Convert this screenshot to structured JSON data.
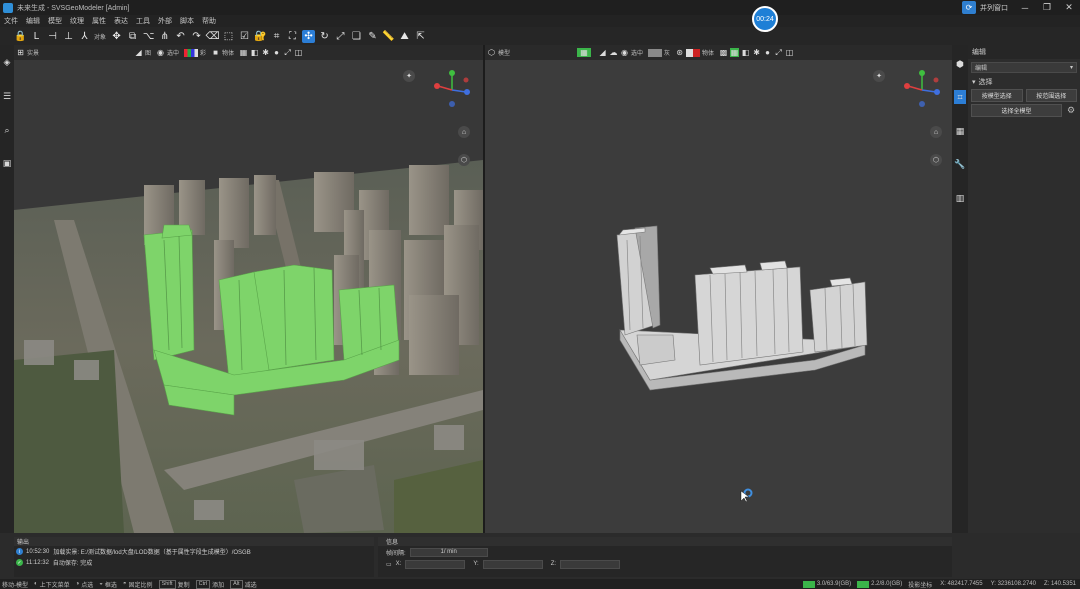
{
  "app": {
    "window_title": "未来生成 - SVSGeoModeler [Admin]",
    "timer": "00:24",
    "user_menu": "并列窗口"
  },
  "menu": [
    "文件",
    "编辑",
    "模型",
    "纹理",
    "属性",
    "表达",
    "工具",
    "外部",
    "脚本",
    "帮助"
  ],
  "toolbar": {
    "align_label": "对象",
    "icons": [
      "lock-icon",
      "axis-l-icon",
      "snap-icon",
      "axis-icon",
      "rotate-axis-icon",
      "move-arrows-icon",
      "copy-icon",
      "tree-icon",
      "graph-icon",
      "undo-icon",
      "redo-icon",
      "delete-icon",
      "frame-select-icon",
      "check-icon",
      "lock-closed-icon",
      "select-region-icon",
      "screen-select-icon",
      "move-tool-icon",
      "rotate-tool-icon",
      "scale-tool-icon",
      "copy-tool-icon",
      "pencil-icon",
      "ruler-icon",
      "terrain-icon",
      "export-icon"
    ]
  },
  "left_viewport": {
    "bar_items": [
      "实景",
      "图",
      "选中",
      "彩",
      "物体"
    ],
    "colors": {
      "highlight": "#7ed46a"
    }
  },
  "right_viewport": {
    "bar_items": [
      "模型",
      "选中",
      "灰",
      "物体"
    ],
    "colors": {
      "model": "#c9c9c9"
    }
  },
  "edit_panel": {
    "title": "编辑",
    "combo": "编辑",
    "section": "选择",
    "btn_select_by_model": "按模型选择",
    "btn_select_by_attr": "按范围选择",
    "btn_select_all": "选择全模型"
  },
  "output": {
    "title": "输出",
    "rows": [
      {
        "time": "10:52:30",
        "text": "加载实景: E:/测试数据/lod大盘/LOD数据（基于属性字段生成模型）/OSGB",
        "status": "info"
      },
      {
        "time": "11:12:32",
        "text": "自动保存: 完成",
        "status": "ok"
      }
    ]
  },
  "info": {
    "title": "信息",
    "render_label": "帧间隔:",
    "render_value": "1/ min",
    "x_label": "X:",
    "y_label": "Y:",
    "z_label": "Z:"
  },
  "status": {
    "mode": "移动-模型",
    "hint1": "上下文菜单",
    "hint2": "点选",
    "hint3": "框选",
    "hint4": "固定比例",
    "key1": "Shift",
    "hint5": "复制",
    "key2": "Ctrl",
    "hint6": "添加",
    "key3": "Alt",
    "hint7": "减选",
    "mem1": "3.0/63.9(GB)",
    "mem2": "2.2/8.0(GB)",
    "coord_label": "投影坐标",
    "x": "X: 482417.7455",
    "y": "Y: 3236108.2740",
    "z": "Z: 140.5351"
  }
}
